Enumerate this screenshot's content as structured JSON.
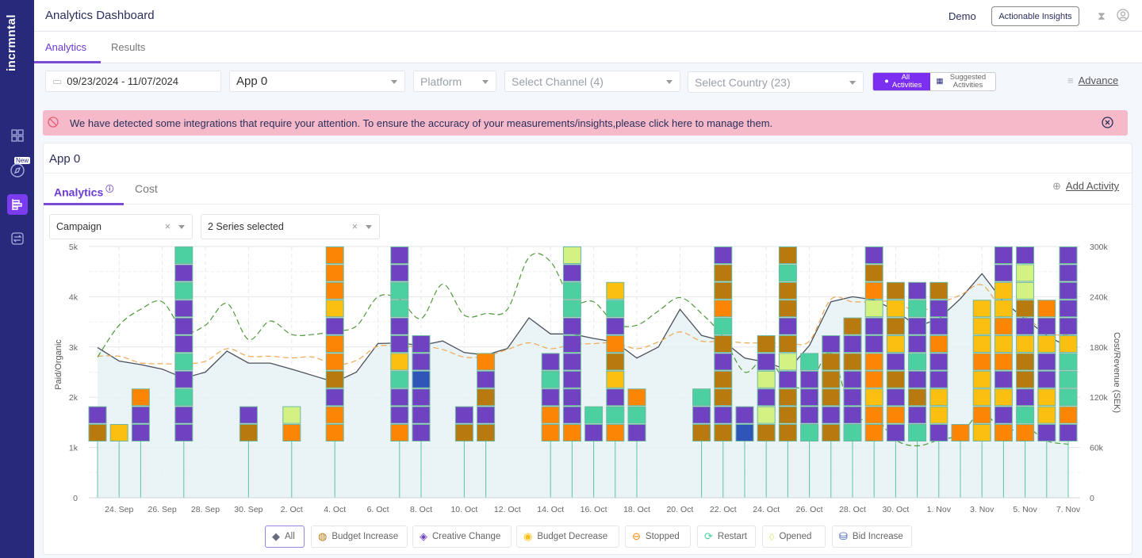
{
  "sidebar": {
    "logo": "incrmntal",
    "new_badge": "New",
    "items": [
      {
        "icon": "dashboard-grid-icon"
      },
      {
        "icon": "compass-icon"
      },
      {
        "icon": "analytics-bars-icon",
        "active": true
      },
      {
        "icon": "swap-icon"
      }
    ]
  },
  "header": {
    "title": "Analytics Dashboard",
    "workspace": "Demo",
    "insights_button": "Actionable Insights"
  },
  "tabs": [
    {
      "label": "Analytics",
      "active": true
    },
    {
      "label": "Results"
    }
  ],
  "filters": {
    "date_range": "09/23/2024 - 11/07/2024",
    "app": "App 0",
    "platform_placeholder": "Platform",
    "channel_placeholder": "Select Channel (4)",
    "country_placeholder": "Select Country (23)",
    "all_activities": "All Activities",
    "suggested_activities": "Suggested Activities",
    "advance": "Advance"
  },
  "alert": {
    "text": "We have detected some integrations that require your attention. To ensure the accuracy of your measurements/insights,please click here to manage them.",
    "color": "#f6b9c9"
  },
  "card": {
    "title": "App 0",
    "tabs": [
      {
        "label": "Analytics",
        "active": true
      },
      {
        "label": "Cost"
      }
    ],
    "add_activity": "Add Activity",
    "group_select": "Campaign",
    "series_select": "2 Series selected"
  },
  "legend": [
    {
      "label": "All",
      "selected": true,
      "icon": "diamond-icon",
      "color": "#6b6b80"
    },
    {
      "label": "Budget Increase",
      "icon": "moneybag-icon",
      "color": "#b8790f"
    },
    {
      "label": "Creative Change",
      "icon": "creative-diamond-icon",
      "color": "#6f42c1"
    },
    {
      "label": "Budget Decrease",
      "icon": "coins-icon",
      "color": "#fbbf12"
    },
    {
      "label": "Stopped",
      "icon": "stop-icon",
      "color": "#fd8505"
    },
    {
      "label": "Restart",
      "icon": "restart-icon",
      "color": "#4dd0a1"
    },
    {
      "label": "Opened",
      "icon": "open-icon",
      "color": "#d4f283"
    },
    {
      "label": "Bid Increase",
      "icon": "bid-icon",
      "color": "#2f55b8"
    }
  ],
  "chart_data": {
    "type": "line",
    "yleft": {
      "label": "Paid/Organic",
      "ticks": [
        "0",
        "1k",
        "2k",
        "3k",
        "4k",
        "5k"
      ],
      "range": [
        0,
        5000
      ]
    },
    "yright": {
      "label": "Cost/Revenue (SEK)",
      "ticks": [
        "0",
        "60k",
        "120k",
        "180k",
        "240k",
        "300k"
      ],
      "range": [
        0,
        300000
      ]
    },
    "x_ticks": [
      "24. Sep",
      "26. Sep",
      "28. Sep",
      "30. Sep",
      "2. Oct",
      "4. Oct",
      "6. Oct",
      "8. Oct",
      "10. Oct",
      "12. Oct",
      "14. Oct",
      "16. Oct",
      "18. Oct",
      "20. Oct",
      "22. Oct",
      "24. Oct",
      "26. Oct",
      "28. Oct",
      "30. Oct",
      "1. Nov",
      "3. Nov",
      "5. Nov",
      "7. Nov"
    ],
    "x_tick_dates": [
      "2024-09-24",
      "2024-09-26",
      "2024-09-28",
      "2024-09-30",
      "2024-10-02",
      "2024-10-04",
      "2024-10-06",
      "2024-10-08",
      "2024-10-10",
      "2024-10-12",
      "2024-10-14",
      "2024-10-16",
      "2024-10-18",
      "2024-10-20",
      "2024-10-22",
      "2024-10-24",
      "2024-10-26",
      "2024-10-28",
      "2024-10-30",
      "2024-11-01",
      "2024-11-03",
      "2024-11-05",
      "2024-11-07"
    ],
    "grid": true,
    "dates": [
      "2024-09-23",
      "2024-09-24",
      "2024-09-25",
      "2024-09-26",
      "2024-09-27",
      "2024-09-28",
      "2024-09-29",
      "2024-09-30",
      "2024-10-01",
      "2024-10-02",
      "2024-10-03",
      "2024-10-04",
      "2024-10-05",
      "2024-10-06",
      "2024-10-07",
      "2024-10-08",
      "2024-10-09",
      "2024-10-10",
      "2024-10-11",
      "2024-10-12",
      "2024-10-13",
      "2024-10-14",
      "2024-10-15",
      "2024-10-16",
      "2024-10-17",
      "2024-10-18",
      "2024-10-19",
      "2024-10-20",
      "2024-10-21",
      "2024-10-22",
      "2024-10-23",
      "2024-10-24",
      "2024-10-25",
      "2024-10-26",
      "2024-10-27",
      "2024-10-28",
      "2024-10-29",
      "2024-10-30",
      "2024-10-31",
      "2024-11-01",
      "2024-11-02",
      "2024-11-03",
      "2024-11-04",
      "2024-11-05",
      "2024-11-06",
      "2024-11-07"
    ],
    "series": [
      {
        "axis": "left",
        "style": "solid-area",
        "color": "#4a4f5c",
        "values": [
          2990,
          2720,
          2650,
          2560,
          2380,
          2500,
          2920,
          2680,
          2680,
          2560,
          2430,
          2300,
          2500,
          3070,
          3080,
          3030,
          3120,
          2890,
          2840,
          2970,
          3580,
          3260,
          3260,
          3170,
          3100,
          2780,
          3000,
          3750,
          3230,
          3120,
          2780,
          2700,
          2540,
          3030,
          3900,
          4000,
          3940,
          3720,
          3410,
          3560,
          3960,
          4460,
          3900,
          3560,
          3230,
          3000
        ]
      },
      {
        "axis": "right",
        "style": "dashed",
        "color": "#f0a850",
        "values": [
          169000,
          169000,
          161000,
          160000,
          160000,
          163000,
          178000,
          169000,
          169000,
          167000,
          168000,
          159000,
          164000,
          181000,
          180000,
          181000,
          177000,
          168000,
          169000,
          177000,
          185000,
          178000,
          183000,
          184000,
          185000,
          178000,
          186000,
          198000,
          187000,
          187000,
          185000,
          185000,
          185000,
          187000,
          237000,
          234000,
          234000,
          234000,
          222000,
          232000,
          242000,
          254000,
          223000,
          216000,
          197000,
          194000
        ]
      },
      {
        "axis": "right",
        "style": "dashed",
        "color": "#4f9a3a",
        "values": [
          168000,
          206000,
          225000,
          234000,
          199000,
          206000,
          232000,
          189000,
          211000,
          195000,
          195000,
          199000,
          205000,
          240000,
          237000,
          214000,
          255000,
          218000,
          220000,
          225000,
          287000,
          282000,
          235000,
          234000,
          208000,
          206000,
          223000,
          239000,
          220000,
          192000,
          150000,
          168000,
          136000,
          135000,
          173000,
          97000,
          97000,
          69000,
          62000,
          69000,
          76000,
          102000,
          79000,
          85000,
          68000,
          64000
        ]
      }
    ],
    "activities": [
      {
        "date": "2024-09-23",
        "stack": [
          "Budget Increase",
          "Creative Change"
        ]
      },
      {
        "date": "2024-09-24",
        "stack": [
          "Budget Decrease"
        ]
      },
      {
        "date": "2024-09-25",
        "stack": [
          "Creative Change",
          "Creative Change",
          "Stopped"
        ]
      },
      {
        "date": "2024-09-27",
        "stack": [
          "Creative Change",
          "Creative Change",
          "Restart",
          "Creative Change",
          "Restart",
          "Creative Change",
          "Creative Change",
          "Creative Change",
          "Restart",
          "Creative Change",
          "Restart"
        ]
      },
      {
        "date": "2024-09-30",
        "stack": [
          "Budget Increase",
          "Creative Change"
        ]
      },
      {
        "date": "2024-10-02",
        "stack": [
          "Stopped",
          "Opened"
        ]
      },
      {
        "date": "2024-10-04",
        "stack": [
          "Stopped",
          "Stopped",
          "Creative Change",
          "Budget Increase",
          "Stopped",
          "Stopped",
          "Creative Change",
          "Budget Decrease",
          "Stopped",
          "Stopped",
          "Stopped"
        ]
      },
      {
        "date": "2024-10-07",
        "stack": [
          "Stopped",
          "Creative Change",
          "Creative Change",
          "Restart",
          "Budget Decrease",
          "Creative Change",
          "Creative Change",
          "Restart",
          "Restart",
          "Creative Change",
          "Creative Change"
        ]
      },
      {
        "date": "2024-10-08",
        "stack": [
          "Creative Change",
          "Creative Change",
          "Creative Change",
          "Bid Increase",
          "Creative Change",
          "Creative Change"
        ]
      },
      {
        "date": "2024-10-10",
        "stack": [
          "Budget Increase",
          "Creative Change"
        ]
      },
      {
        "date": "2024-10-11",
        "stack": [
          "Budget Increase",
          "Creative Change",
          "Budget Increase",
          "Creative Change",
          "Stopped"
        ]
      },
      {
        "date": "2024-10-14",
        "stack": [
          "Stopped",
          "Stopped",
          "Creative Change",
          "Restart",
          "Creative Change"
        ]
      },
      {
        "date": "2024-10-15",
        "stack": [
          "Stopped",
          "Creative Change",
          "Creative Change",
          "Creative Change",
          "Creative Change",
          "Creative Change",
          "Creative Change",
          "Restart",
          "Restart",
          "Creative Change",
          "Opened"
        ]
      },
      {
        "date": "2024-10-16",
        "stack": [
          "Creative Change",
          "Restart"
        ]
      },
      {
        "date": "2024-10-17",
        "stack": [
          "Stopped",
          "Restart",
          "Creative Change",
          "Budget Decrease",
          "Budget Increase",
          "Stopped",
          "Creative Change",
          "Restart",
          "Budget Decrease"
        ]
      },
      {
        "date": "2024-10-18",
        "stack": [
          "Creative Change",
          "Restart",
          "Stopped"
        ]
      },
      {
        "date": "2024-10-21",
        "stack": [
          "Budget Increase",
          "Creative Change",
          "Restart"
        ]
      },
      {
        "date": "2024-10-22",
        "stack": [
          "Budget Increase",
          "Creative Change",
          "Budget Increase",
          "Budget Increase",
          "Creative Change",
          "Budget Increase",
          "Restart",
          "Stopped",
          "Budget Increase",
          "Budget Increase",
          "Creative Change"
        ]
      },
      {
        "date": "2024-10-23",
        "stack": [
          "Bid Increase",
          "Creative Change"
        ]
      },
      {
        "date": "2024-10-24",
        "stack": [
          "Budget Increase",
          "Opened",
          "Creative Change",
          "Opened",
          "Creative Change",
          "Budget Increase"
        ]
      },
      {
        "date": "2024-10-25",
        "stack": [
          "Budget Increase",
          "Budget Increase",
          "Budget Increase",
          "Creative Change",
          "Opened",
          "Budget Increase",
          "Creative Change",
          "Budget Increase",
          "Budget Increase",
          "Restart",
          "Budget Increase"
        ]
      },
      {
        "date": "2024-10-26",
        "stack": [
          "Restart",
          "Creative Change",
          "Creative Change",
          "Creative Change",
          "Restart"
        ]
      },
      {
        "date": "2024-10-27",
        "stack": [
          "Budget Increase",
          "Creative Change",
          "Budget Increase",
          "Budget Increase",
          "Budget Increase",
          "Creative Change"
        ]
      },
      {
        "date": "2024-10-28",
        "stack": [
          "Restart",
          "Creative Change",
          "Creative Change",
          "Creative Change",
          "Budget Increase",
          "Creative Change",
          "Budget Increase"
        ]
      },
      {
        "date": "2024-10-29",
        "stack": [
          "Stopped",
          "Stopped",
          "Budget Decrease",
          "Stopped",
          "Stopped",
          "Creative Change",
          "Creative Change",
          "Opened",
          "Stopped",
          "Budget Increase",
          "Creative Change"
        ]
      },
      {
        "date": "2024-10-30",
        "stack": [
          "Creative Change",
          "Stopped",
          "Creative Change",
          "Budget Increase",
          "Creative Change",
          "Budget Decrease",
          "Budget Increase",
          "Budget Decrease",
          "Budget Increase"
        ]
      },
      {
        "date": "2024-10-31",
        "stack": [
          "Restart",
          "Creative Change",
          "Budget Increase",
          "Creative Change",
          "Restart",
          "Creative Change",
          "Creative Change",
          "Restart",
          "Creative Change"
        ]
      },
      {
        "date": "2024-11-01",
        "stack": [
          "Creative Change",
          "Budget Decrease",
          "Budget Decrease",
          "Creative Change",
          "Creative Change",
          "Stopped",
          "Creative Change",
          "Creative Change",
          "Budget Increase"
        ]
      },
      {
        "date": "2024-11-02",
        "stack": [
          "Stopped"
        ]
      },
      {
        "date": "2024-11-03",
        "stack": [
          "Budget Decrease",
          "Stopped",
          "Budget Decrease",
          "Budget Decrease",
          "Stopped",
          "Budget Decrease",
          "Budget Decrease",
          "Budget Decrease"
        ]
      },
      {
        "date": "2024-11-04",
        "stack": [
          "Stopped",
          "Creative Change",
          "Budget Decrease",
          "Creative Change",
          "Stopped",
          "Budget Decrease",
          "Stopped",
          "Budget Decrease",
          "Budget Decrease",
          "Creative Change",
          "Creative Change"
        ]
      },
      {
        "date": "2024-11-05",
        "stack": [
          "Stopped",
          "Restart",
          "Creative Change",
          "Budget Increase",
          "Budget Increase",
          "Budget Decrease",
          "Creative Change",
          "Budget Increase",
          "Opened",
          "Opened",
          "Creative Change"
        ]
      },
      {
        "date": "2024-11-06",
        "stack": [
          "Creative Change",
          "Budget Decrease",
          "Budget Decrease",
          "Creative Change",
          "Creative Change",
          "Budget Decrease",
          "Creative Change",
          "Stopped"
        ]
      },
      {
        "date": "2024-11-07",
        "stack": [
          "Creative Change",
          "Stopped",
          "Restart",
          "Restart",
          "Restart",
          "Budget Decrease",
          "Creative Change",
          "Creative Change",
          "Creative Change",
          "Creative Change",
          "Creative Change"
        ]
      }
    ]
  }
}
